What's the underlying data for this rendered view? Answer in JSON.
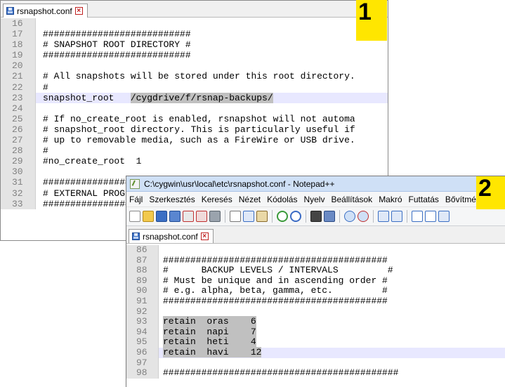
{
  "window1": {
    "tab_label": "rsnapshot.conf",
    "badge": "1",
    "lines": [
      {
        "num": "16",
        "text": ""
      },
      {
        "num": "17",
        "text": "###########################"
      },
      {
        "num": "18",
        "text": "# SNAPSHOT ROOT DIRECTORY #"
      },
      {
        "num": "19",
        "text": "###########################"
      },
      {
        "num": "20",
        "text": ""
      },
      {
        "num": "21",
        "text": "# All snapshots will be stored under this root directory."
      },
      {
        "num": "22",
        "text": "#"
      },
      {
        "num": "23",
        "text_pre": "snapshot_root   ",
        "text_sel": "/cygdrive/f/rsnap-backups/",
        "current": true
      },
      {
        "num": "24",
        "text": ""
      },
      {
        "num": "25",
        "text": "# If no_create_root is enabled, rsnapshot will not automa"
      },
      {
        "num": "26",
        "text": "# snapshot_root directory. This is particularly useful if"
      },
      {
        "num": "27",
        "text": "# up to removable media, such as a FireWire or USB drive."
      },
      {
        "num": "28",
        "text": "#"
      },
      {
        "num": "29",
        "text": "#no_create_root  1"
      },
      {
        "num": "30",
        "text": ""
      },
      {
        "num": "31",
        "text": "################################"
      },
      {
        "num": "32",
        "text": "# EXTERNAL PROGRAM DEPENDENCIES #"
      },
      {
        "num": "33",
        "text": "################################"
      }
    ]
  },
  "window2": {
    "title": "C:\\cygwin\\usr\\local\\etc\\rsnapshot.conf - Notepad++",
    "badge": "2",
    "menu": [
      "Fájl",
      "Szerkesztés",
      "Keresés",
      "Nézet",
      "Kódolás",
      "Nyelv",
      "Beállítások",
      "Makró",
      "Futtatás",
      "Bővítmények"
    ],
    "tab_label": "rsnapshot.conf",
    "lines": [
      {
        "num": "86",
        "text": ""
      },
      {
        "num": "87",
        "text": "#########################################"
      },
      {
        "num": "88",
        "text": "#      BACKUP LEVELS / INTERVALS         #"
      },
      {
        "num": "89",
        "text": "# Must be unique and in ascending order #"
      },
      {
        "num": "90",
        "text": "# e.g. alpha, beta, gamma, etc.         #"
      },
      {
        "num": "91",
        "text": "#########################################"
      },
      {
        "num": "92",
        "text": ""
      },
      {
        "num": "93",
        "text_sel": "retain  oras    6"
      },
      {
        "num": "94",
        "text_sel": "retain  napi    7"
      },
      {
        "num": "95",
        "text_sel": "retain  heti    4"
      },
      {
        "num": "96",
        "text_sel": "retain  havi    12",
        "current": true
      },
      {
        "num": "97",
        "text": ""
      },
      {
        "num": "98",
        "text": "###########################################"
      }
    ]
  },
  "colors": {
    "badge": "#ffe600",
    "selection": "#c0c0c0",
    "current_line": "#e8e8ff",
    "gutter": "#e4e4e4",
    "titlebar": "#cfe0f6"
  },
  "icons": [
    "save-icon",
    "close-tab-icon",
    "new-file-icon",
    "open-file-icon",
    "save-all-icon",
    "close-icon",
    "print-icon",
    "cut-icon",
    "copy-icon",
    "paste-icon",
    "undo-icon",
    "redo-icon",
    "find-icon",
    "replace-icon",
    "zoom-in-icon",
    "zoom-out-icon",
    "sync-scroll-icon",
    "word-wrap-icon",
    "show-all-chars-icon",
    "indent-guide-icon"
  ]
}
